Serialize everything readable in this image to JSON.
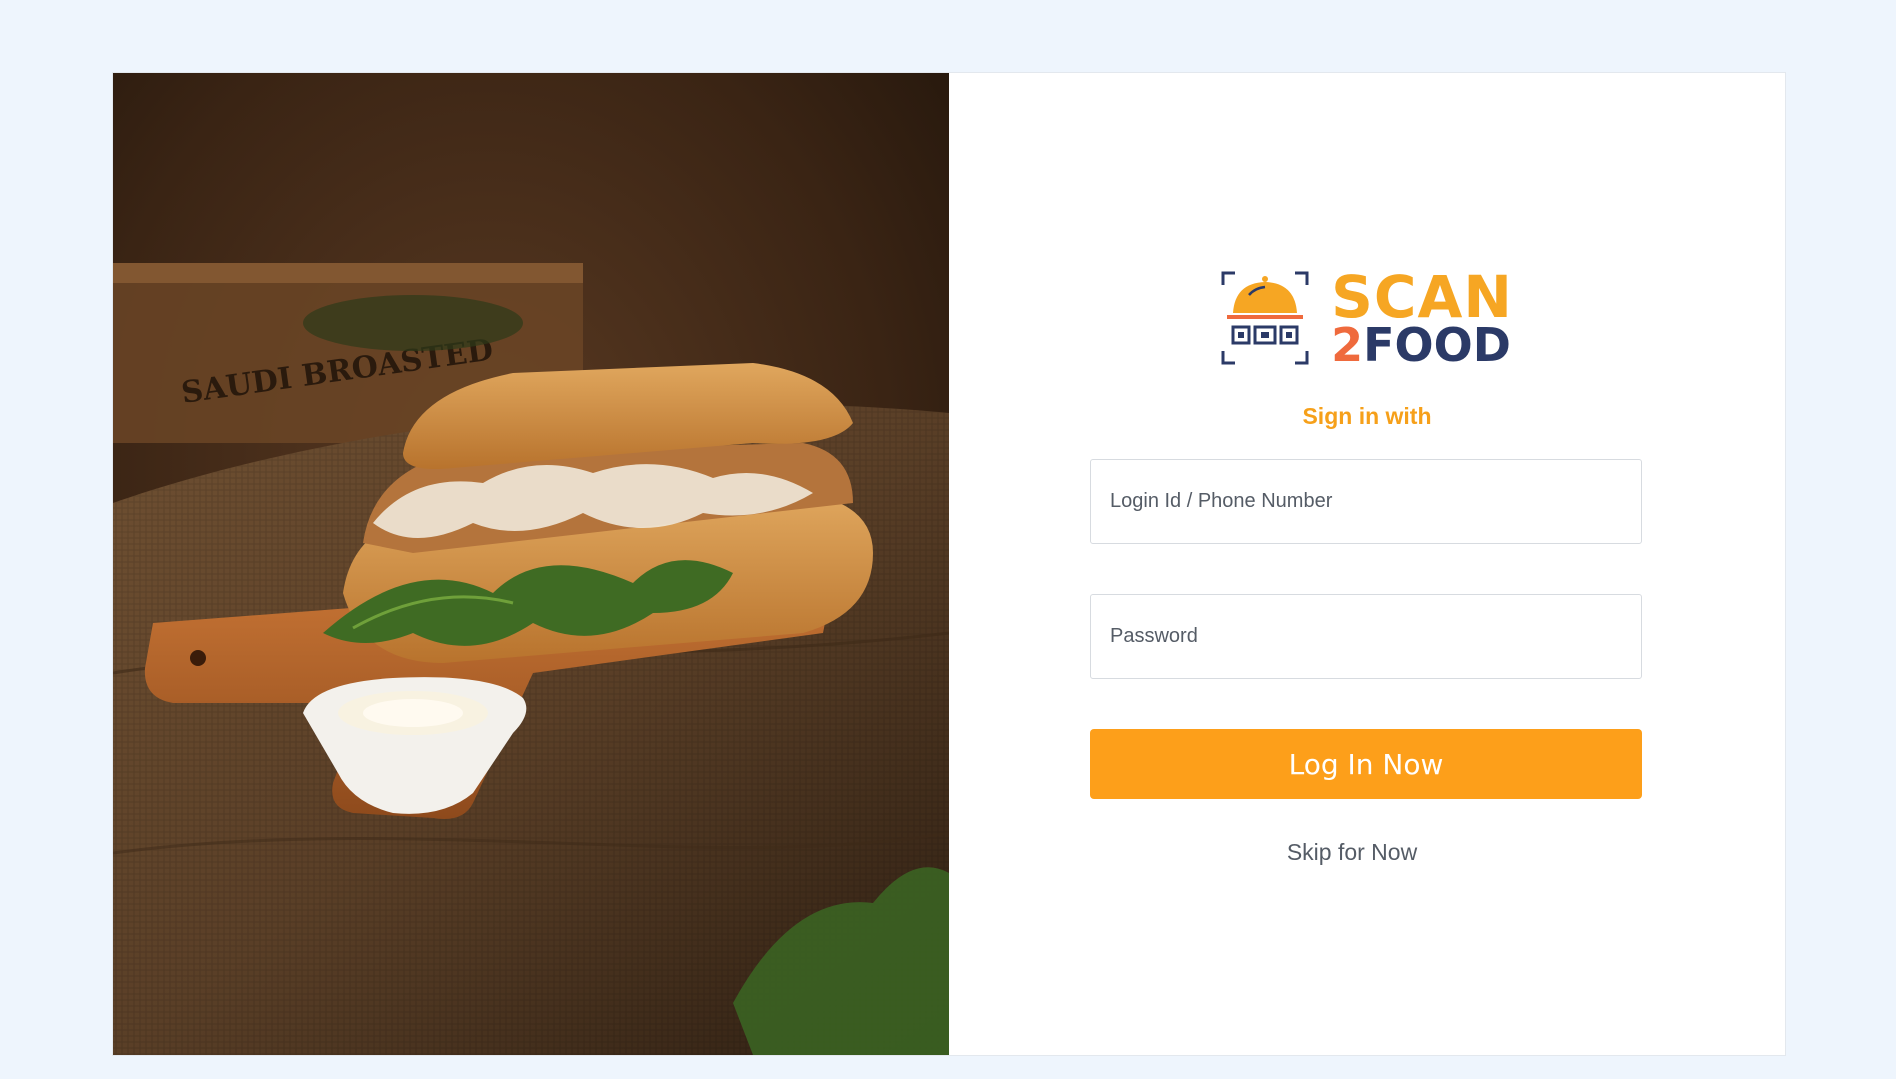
{
  "hero": {
    "alt": "Chicken sandwich on a wooden board",
    "crate_text": "SAUDI BROASTED"
  },
  "brand": {
    "name_top": "SCAN",
    "name_digit": "2",
    "name_bottom": "FOOD",
    "colors": {
      "orange": "#f6a623",
      "navy": "#2b3a67",
      "red": "#ef6a3d"
    }
  },
  "form": {
    "heading": "Sign in with",
    "login_placeholder": "Login Id / Phone Number",
    "password_placeholder": "Password",
    "submit_label": "Log In Now",
    "skip_label": "Skip for Now"
  },
  "colors": {
    "accent": "#fd9f1a",
    "background": "#eef5fd"
  }
}
